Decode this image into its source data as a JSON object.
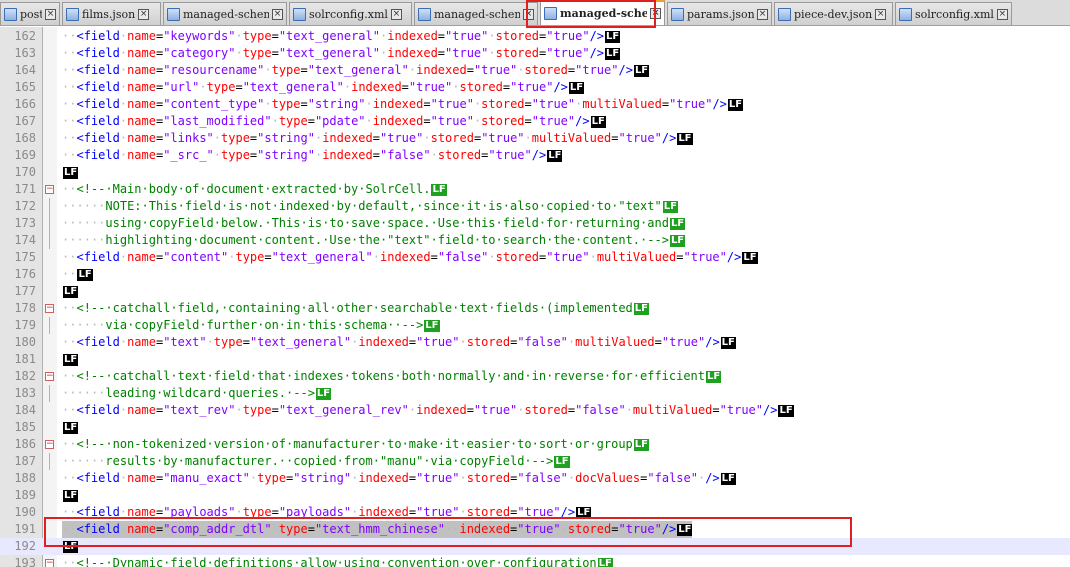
{
  "tabs": [
    {
      "label": "post",
      "active": false
    },
    {
      "label": "films.json",
      "active": false
    },
    {
      "label": "managed-schema",
      "active": false
    },
    {
      "label": "solrconfig.xml",
      "active": false
    },
    {
      "label": "managed-schema",
      "active": false
    },
    {
      "label": "managed-schema",
      "active": true
    },
    {
      "label": "params.json",
      "active": false
    },
    {
      "label": "piece-dev.json",
      "active": false
    },
    {
      "label": "solrconfig.xml",
      "active": false
    }
  ],
  "eol_marker": "LF",
  "lines": [
    {
      "n": "162",
      "text": "  <field name=\"keywords\" type=\"text_general\" indexed=\"true\" stored=\"true\"/>"
    },
    {
      "n": "163",
      "text": "  <field name=\"category\" type=\"text_general\" indexed=\"true\" stored=\"true\"/>"
    },
    {
      "n": "164",
      "text": "  <field name=\"resourcename\" type=\"text_general\" indexed=\"true\" stored=\"true\"/>"
    },
    {
      "n": "165",
      "text": "  <field name=\"url\" type=\"text_general\" indexed=\"true\" stored=\"true\"/>"
    },
    {
      "n": "166",
      "text": "  <field name=\"content_type\" type=\"string\" indexed=\"true\" stored=\"true\" multiValued=\"true\"/>"
    },
    {
      "n": "167",
      "text": "  <field name=\"last_modified\" type=\"pdate\" indexed=\"true\" stored=\"true\"/>"
    },
    {
      "n": "168",
      "text": "  <field name=\"links\" type=\"string\" indexed=\"true\" stored=\"true\" multiValued=\"true\"/>"
    },
    {
      "n": "169",
      "text": "  <field name=\"_src_\" type=\"string\" indexed=\"false\" stored=\"true\"/>"
    },
    {
      "n": "170",
      "text": ""
    },
    {
      "n": "171",
      "text": "  <!-- Main body of document extracted by SolrCell.",
      "comment": "start"
    },
    {
      "n": "172",
      "text": "      NOTE: This field is not indexed by default, since it is also copied to \"text\"",
      "comment": "mid"
    },
    {
      "n": "173",
      "text": "      using copyField below. This is to save space. Use this field for returning and",
      "comment": "mid"
    },
    {
      "n": "174",
      "text": "      highlighting document content. Use the \"text\" field to search the content. -->",
      "comment": "end"
    },
    {
      "n": "175",
      "text": "  <field name=\"content\" type=\"text_general\" indexed=\"false\" stored=\"true\" multiValued=\"true\"/>"
    },
    {
      "n": "176",
      "text": "  "
    },
    {
      "n": "177",
      "text": ""
    },
    {
      "n": "178",
      "text": "  <!-- catchall field, containing all other searchable text fields (implemented",
      "comment": "start"
    },
    {
      "n": "179",
      "text": "      via copyField further on in this schema  -->",
      "comment": "end"
    },
    {
      "n": "180",
      "text": "  <field name=\"text\" type=\"text_general\" indexed=\"true\" stored=\"false\" multiValued=\"true\"/>"
    },
    {
      "n": "181",
      "text": ""
    },
    {
      "n": "182",
      "text": "  <!-- catchall text field that indexes tokens both normally and in reverse for efficient",
      "comment": "start"
    },
    {
      "n": "183",
      "text": "      leading wildcard queries. -->",
      "comment": "end"
    },
    {
      "n": "184",
      "text": "  <field name=\"text_rev\" type=\"text_general_rev\" indexed=\"true\" stored=\"false\" multiValued=\"true\"/>"
    },
    {
      "n": "185",
      "text": ""
    },
    {
      "n": "186",
      "text": "  <!-- non-tokenized version of manufacturer to make it easier to sort or group",
      "comment": "start"
    },
    {
      "n": "187",
      "text": "      results by manufacturer.  copied from \"manu\" via copyField -->",
      "comment": "end"
    },
    {
      "n": "188",
      "text": "  <field name=\"manu_exact\" type=\"string\" indexed=\"true\" stored=\"false\" docValues=\"false\" />"
    },
    {
      "n": "189",
      "text": ""
    },
    {
      "n": "190",
      "text": "  <field name=\"payloads\" type=\"payloads\" indexed=\"true\" stored=\"true\"/>"
    },
    {
      "n": "191",
      "text": "  <field name=\"comp_addr_dtl\" type=\"text_hmm_chinese\"  indexed=\"true\" stored=\"true\"/>",
      "selected": true
    },
    {
      "n": "192",
      "text": "",
      "current": true
    },
    {
      "n": "193",
      "text": "  <!-- Dynamic field definitions allow using convention over configuration",
      "comment": "start"
    }
  ]
}
